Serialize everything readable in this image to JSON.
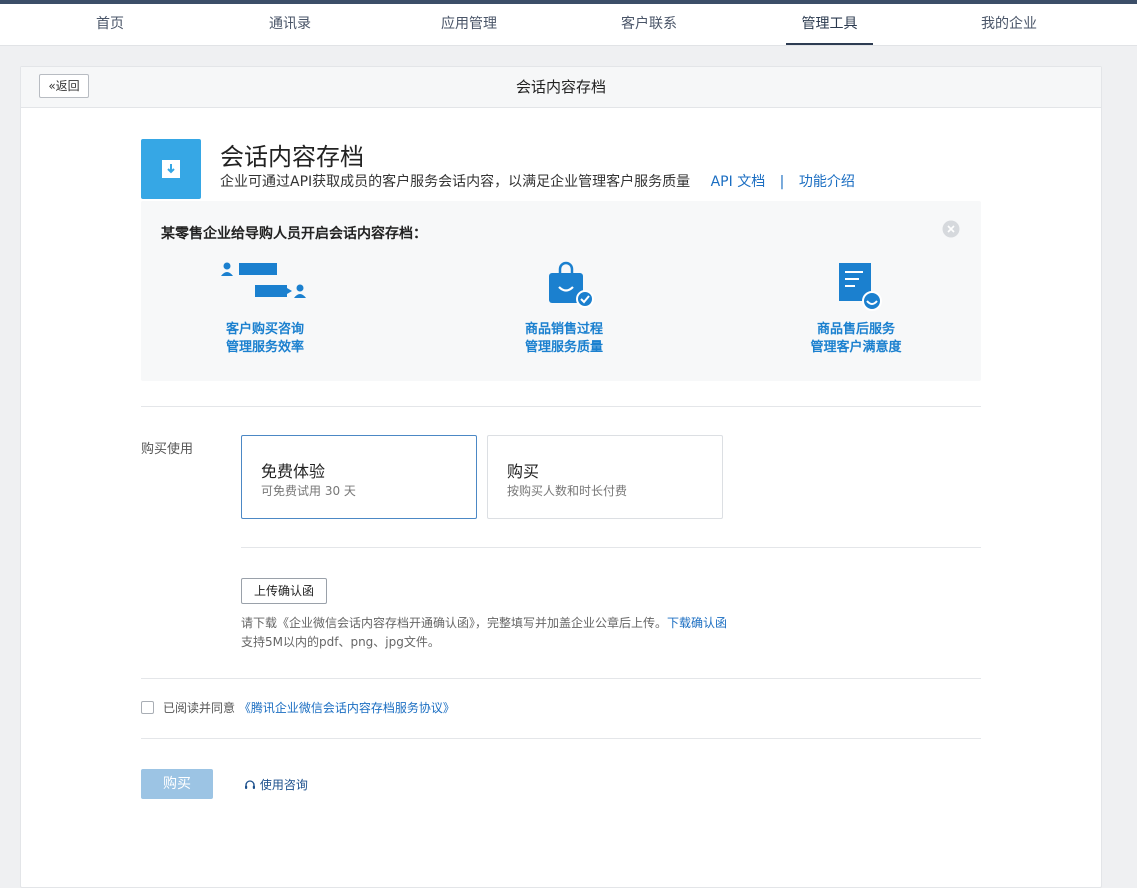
{
  "nav": {
    "items": [
      "首页",
      "通讯录",
      "应用管理",
      "客户联系",
      "管理工具",
      "我的企业"
    ],
    "active_index": 4
  },
  "page": {
    "back_label": "返回",
    "title": "会话内容存档"
  },
  "hero": {
    "icon": "download-archive-icon",
    "title": "会话内容存档",
    "description": "企业可通过API获取成员的客户服务会话内容，以满足企业管理客户服务质量",
    "api_link": "API 文档",
    "separator": "|",
    "intro_link": "功能介绍"
  },
  "tip": {
    "title": "某零售企业给导购人员开启会话内容存档：",
    "features": [
      {
        "icon": "chat-consult-icon",
        "line1": "客户购买咨询",
        "line2": "管理服务效率"
      },
      {
        "icon": "shopping-bag-check-icon",
        "line1": "商品销售过程",
        "line2": "管理服务质量"
      },
      {
        "icon": "document-smile-icon",
        "line1": "商品售后服务",
        "line2": "管理客户满意度"
      }
    ]
  },
  "purchase": {
    "label": "购买使用",
    "options": [
      {
        "title": "免费体验",
        "subtitle": "可免费试用 30 天",
        "selected": true
      },
      {
        "title": "购买",
        "subtitle": "按购买人数和时长付费",
        "selected": false
      }
    ]
  },
  "upload": {
    "button_label": "上传确认函",
    "note_text": "请下载《企业微信会话内容存档开通确认函》，完整填写并加盖企业公章后上传。",
    "download_link": "下载确认函",
    "format_note": "支持5M以内的pdf、png、jpg文件。"
  },
  "agreement": {
    "checked": false,
    "prefix": "已阅读并同意",
    "link": "《腾讯企业微信会话内容存档服务协议》"
  },
  "actions": {
    "buy_label": "购买",
    "consult_label": "使用咨询"
  },
  "colors": {
    "accent": "#1b6ec2",
    "icon_blue": "#36a7e5",
    "feature_blue": "#1b80cf",
    "buy_disabled": "#9cc4e4",
    "top_bar": "#3c4e68"
  }
}
